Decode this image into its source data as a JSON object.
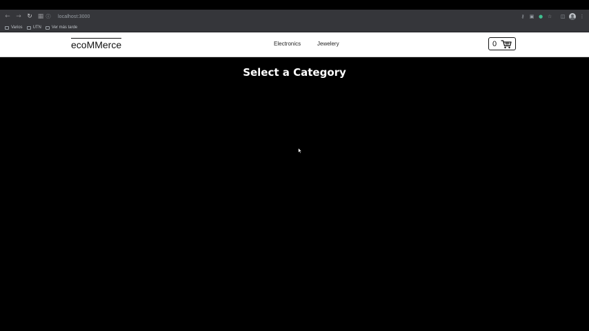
{
  "browser": {
    "address": "localhost:3000",
    "bookmarks": [
      {
        "label": "Varios"
      },
      {
        "label": "UTN"
      },
      {
        "label": "Ver más tarde"
      }
    ],
    "icons": {
      "back": "arrow-left",
      "forward": "arrow-right",
      "reload": "reload",
      "apps": "grid",
      "site_info": "info"
    }
  },
  "header": {
    "logo": "ecoMMerce",
    "nav": [
      {
        "label": "Electronics"
      },
      {
        "label": "Jewelery"
      }
    ],
    "cart": {
      "count": "0",
      "icon": "cart-icon"
    }
  },
  "main": {
    "title": "Select a Category"
  },
  "colors": {
    "page_background": "#000000",
    "header_background": "#ffffff",
    "browser_chrome": "#35363a",
    "title_text": "#ffffff"
  }
}
